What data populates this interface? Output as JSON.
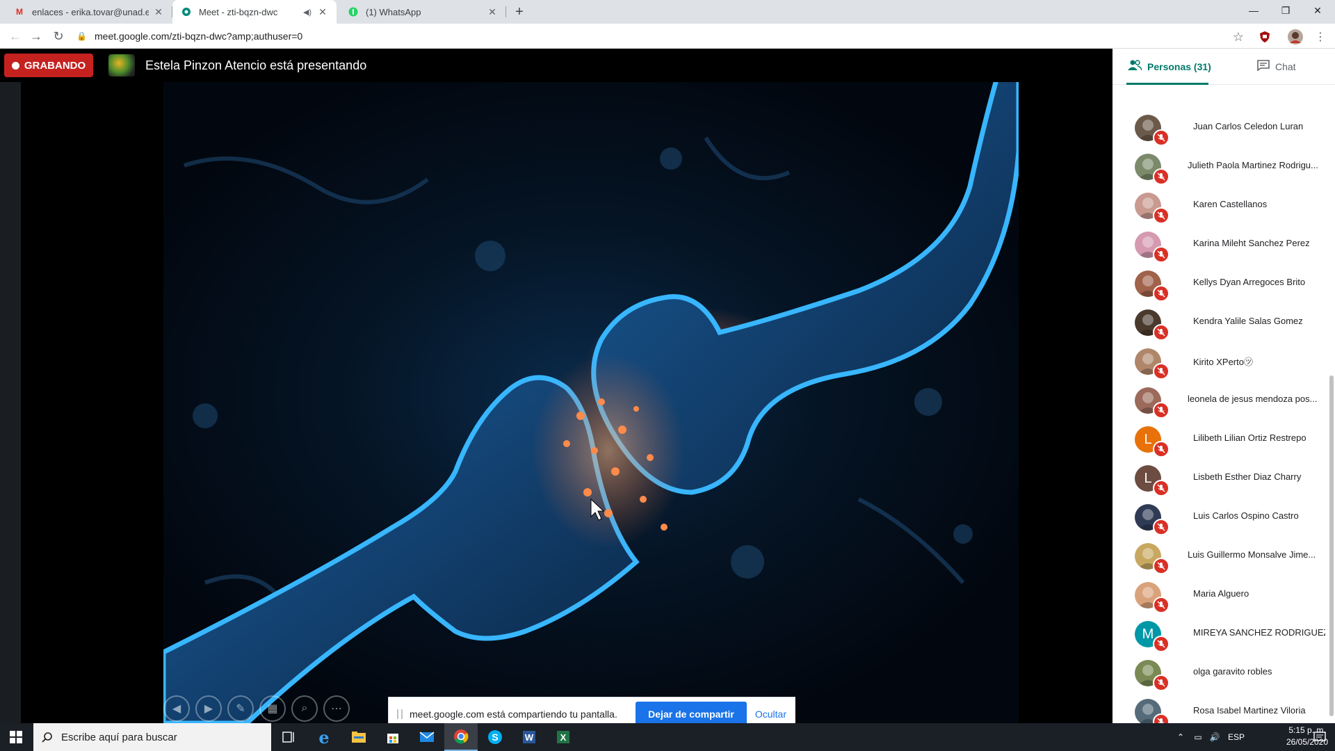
{
  "browser": {
    "tabs": [
      {
        "title": "enlaces - erika.tovar@unad.edu.c",
        "icon": "gmail-icon"
      },
      {
        "title": "Meet - zti-bqzn-dwc",
        "icon": "meet-icon"
      },
      {
        "title": "(1) WhatsApp",
        "icon": "whatsapp-icon"
      }
    ],
    "url": "meet.google.com/zti-bqzn-dwc?amp;authuser=0"
  },
  "meet": {
    "recording_label": "GRABANDO",
    "presenter_text": "Estela Pinzon Atencio está presentando",
    "share_banner": {
      "message": "meet.google.com está compartiendo tu pantalla.",
      "stop_label": "Dejar de compartir",
      "hide_label": "Ocultar"
    }
  },
  "panel": {
    "people_tab": "Personas (31)",
    "chat_tab": "Chat",
    "participants": [
      {
        "name": "Juan Carlos Celedon Luran",
        "initial": "",
        "color": "#6b5a4a"
      },
      {
        "name": "Julieth Paola Martinez Rodrigu...",
        "initial": "",
        "color": "#7a8a6a"
      },
      {
        "name": "Karen Castellanos",
        "initial": "",
        "color": "#c89a90"
      },
      {
        "name": "Karina Mileht Sanchez Perez",
        "initial": "",
        "color": "#d59ab0"
      },
      {
        "name": "Kellys Dyan Arregoces Brito",
        "initial": "",
        "color": "#a0624a"
      },
      {
        "name": "Kendra Yalile Salas Gomez",
        "initial": "",
        "color": "#4a3a2e"
      },
      {
        "name": "Kirito XPerto㋡",
        "initial": "",
        "color": "#b0866a"
      },
      {
        "name": "leonela de jesus mendoza pos...",
        "initial": "",
        "color": "#9c6a5a"
      },
      {
        "name": "Lilibeth Lilian Ortiz Restrepo",
        "initial": "L",
        "color": "#e8710a"
      },
      {
        "name": "Lisbeth Esther Diaz Charry",
        "initial": "L",
        "color": "#6d4c41"
      },
      {
        "name": "Luis Carlos Ospino Castro",
        "initial": "",
        "color": "#2f3b55"
      },
      {
        "name": "Luis Guillermo Monsalve Jime...",
        "initial": "",
        "color": "#c8a860"
      },
      {
        "name": "Maria Alguero",
        "initial": "",
        "color": "#d9a27a"
      },
      {
        "name": "MIREYA SANCHEZ RODRIGUEZ",
        "initial": "M",
        "color": "#0097a7"
      },
      {
        "name": "olga garavito robles",
        "initial": "",
        "color": "#7a8a55"
      },
      {
        "name": "Rosa Isabel Martinez Viloria",
        "initial": "",
        "color": "#556b7a"
      }
    ]
  },
  "taskbar": {
    "search_placeholder": "Escribe aquí para buscar",
    "language": "ESP",
    "time": "5:15 p. m.",
    "date": "26/05/2020"
  }
}
